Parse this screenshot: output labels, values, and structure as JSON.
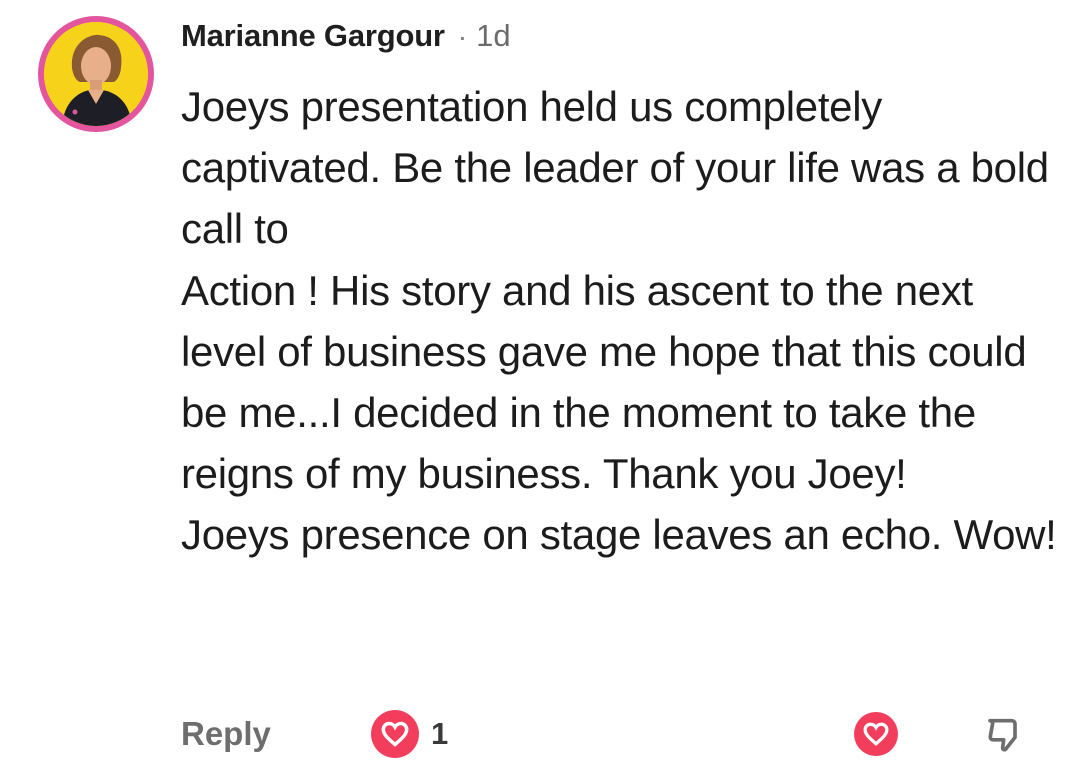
{
  "comment": {
    "author": "Marianne Gargour",
    "separator": "·",
    "time": "1d",
    "avatar": "profile-photo",
    "body_lines": [
      "Joeys presentation held us completely captivated. Be the leader of your life was a bold call to",
      "Action ! His story and his ascent to the next level of business gave me hope that this could be me...I decided in the moment to take the reigns of my business. Thank you Joey!",
      "Joeys presence on stage leaves an echo. Wow!"
    ]
  },
  "actions": {
    "reply_label": "Reply",
    "love_count": "1",
    "love_icon": "heart-icon",
    "react_icon": "heart-icon",
    "dislike_icon": "thumbs-down-icon"
  },
  "colors": {
    "avatar_ring": "#e3559c",
    "avatar_bg": "#f6d21b",
    "heart": "#f23e5c",
    "muted": "#6e6e6e"
  }
}
